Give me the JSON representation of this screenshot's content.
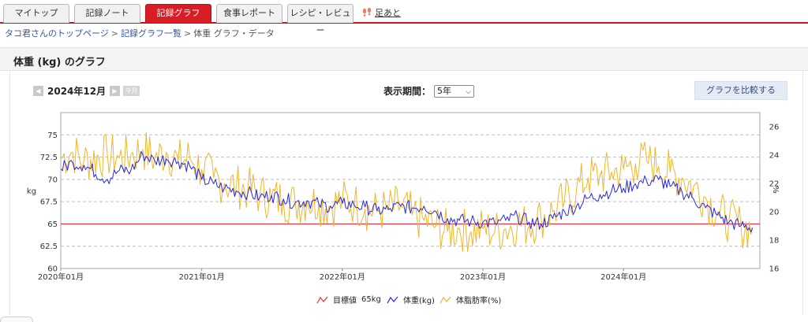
{
  "tabs": [
    {
      "label": "マイトップ",
      "active": false
    },
    {
      "label": "記録ノート",
      "active": false
    },
    {
      "label": "記録グラフ",
      "active": true
    },
    {
      "label": "食事レポート",
      "active": false
    },
    {
      "label": "レシピ・レビュー",
      "active": false
    }
  ],
  "footprints_label": "足あと",
  "breadcrumb": {
    "items": [
      "タコ君さんのトップページ",
      "記録グラフ一覧"
    ],
    "current": "体重 グラフ・データ",
    "separator": ">"
  },
  "section_title": "体重 (kg) のグラフ",
  "controls": {
    "month": "2024年12月",
    "prev_icon": "triangle-left",
    "next_icon": "triangle-right",
    "today_label": "今月",
    "period_label": "表示期間：",
    "period_value": "5年",
    "compare_label": "グラフを比較する"
  },
  "colors": {
    "accent": "#d81e24",
    "target": "#e8303c",
    "weight": "#2828e0",
    "bodyfat": "#f0b628",
    "link": "#3555a4"
  },
  "chart_data": {
    "type": "line",
    "x_tick_labels": [
      "2020年01月",
      "2021年01月",
      "2022年01月",
      "2023年01月",
      "2024年01月"
    ],
    "y_left": {
      "label": "kg",
      "ticks": [
        60,
        62.5,
        65,
        67.5,
        70,
        72.5,
        75
      ],
      "ylim": [
        60,
        77.5
      ]
    },
    "y_right": {
      "label": "%",
      "ticks": [
        16,
        18,
        20,
        22,
        24,
        26
      ],
      "ylim": [
        16,
        27
      ]
    },
    "grid": true,
    "target": {
      "name": "目標値",
      "value_label": "65kg",
      "value": 65
    },
    "series": [
      {
        "name": "体重(kg)",
        "axis": "left",
        "x": [
          "2020-01",
          "2020-02",
          "2020-03",
          "2020-05",
          "2020-06",
          "2020-07",
          "2020-08",
          "2020-09",
          "2020-10",
          "2020-11",
          "2020-12",
          "2021-01",
          "2021-02",
          "2021-03",
          "2021-04",
          "2021-05",
          "2021-06",
          "2021-07",
          "2021-08",
          "2021-09",
          "2021-10",
          "2021-11",
          "2021-12",
          "2022-01",
          "2022-02",
          "2022-03",
          "2022-04",
          "2022-05",
          "2022-06",
          "2022-07",
          "2022-08",
          "2022-09",
          "2022-10",
          "2022-11",
          "2022-12",
          "2023-01",
          "2023-02",
          "2023-03",
          "2023-04",
          "2023-05",
          "2023-06",
          "2023-07",
          "2023-08",
          "2023-09",
          "2023-10",
          "2023-11",
          "2023-12",
          "2024-01",
          "2024-02",
          "2024-03",
          "2024-04",
          "2024-05",
          "2024-06",
          "2024-07",
          "2024-08",
          "2024-09",
          "2024-10",
          "2024-11",
          "2024-12"
        ],
        "values": [
          71.2,
          71.9,
          71.6,
          70.0,
          71.0,
          71.0,
          72.8,
          72.1,
          72.3,
          72.0,
          71.5,
          70.0,
          69.5,
          69.0,
          68.7,
          68.5,
          68.0,
          68.2,
          67.8,
          67.4,
          67.6,
          67.2,
          67.0,
          67.3,
          67.1,
          66.9,
          66.5,
          66.6,
          67.0,
          66.8,
          67.0,
          66.4,
          65.6,
          65.4,
          65.3,
          65.2,
          65.1,
          65.4,
          65.8,
          65.2,
          65.0,
          65.6,
          66.4,
          67.0,
          67.9,
          68.3,
          68.7,
          69.0,
          69.5,
          69.8,
          70.0,
          69.2,
          68.6,
          67.8,
          66.8,
          66.0,
          65.2,
          64.8,
          64.6
        ]
      },
      {
        "name": "体脂肪率(%)",
        "axis": "right",
        "x": [
          "2020-01",
          "2020-02",
          "2020-03",
          "2020-05",
          "2020-06",
          "2020-07",
          "2020-08",
          "2020-09",
          "2020-10",
          "2020-11",
          "2020-12",
          "2021-01",
          "2021-02",
          "2021-03",
          "2021-04",
          "2021-05",
          "2021-06",
          "2021-07",
          "2021-08",
          "2021-09",
          "2021-10",
          "2021-11",
          "2021-12",
          "2022-01",
          "2022-02",
          "2022-03",
          "2022-04",
          "2022-05",
          "2022-06",
          "2022-07",
          "2022-08",
          "2022-09",
          "2022-10",
          "2022-11",
          "2022-12",
          "2023-01",
          "2023-02",
          "2023-03",
          "2023-04",
          "2023-05",
          "2023-06",
          "2023-07",
          "2023-08",
          "2023-09",
          "2023-10",
          "2023-11",
          "2023-12",
          "2024-01",
          "2024-02",
          "2024-03",
          "2024-04",
          "2024-05",
          "2024-06",
          "2024-07",
          "2024-08",
          "2024-09",
          "2024-10",
          "2024-11",
          "2024-12"
        ],
        "values": [
          23.8,
          24.2,
          23.6,
          24.0,
          23.8,
          24.0,
          24.4,
          23.8,
          24.2,
          23.6,
          23.8,
          23.0,
          22.4,
          22.0,
          21.8,
          21.6,
          21.2,
          21.0,
          20.8,
          20.6,
          20.8,
          20.6,
          20.4,
          20.8,
          20.6,
          20.2,
          20.0,
          20.2,
          20.4,
          19.8,
          19.4,
          19.0,
          18.6,
          18.8,
          18.6,
          18.8,
          18.6,
          18.8,
          19.2,
          19.0,
          19.6,
          20.0,
          20.8,
          21.6,
          22.4,
          22.6,
          22.8,
          23.0,
          23.4,
          23.6,
          23.2,
          22.8,
          22.4,
          21.8,
          21.0,
          20.0,
          19.4,
          19.0,
          18.8
        ]
      }
    ]
  }
}
